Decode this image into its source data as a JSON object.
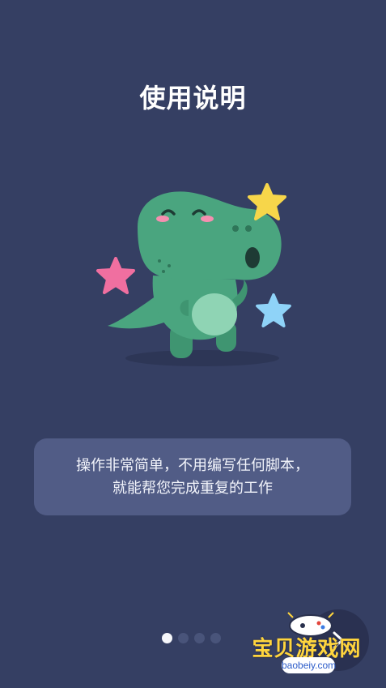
{
  "page": {
    "title": "使用说明"
  },
  "illustration": {
    "icon": "dinosaur-illustration"
  },
  "info_card": {
    "line1": "操作非常简单，不用编写任何脚本，",
    "line2": "就能帮您完成重复的工作"
  },
  "pagination": {
    "dots": 4,
    "active_index": 0
  },
  "next_button": {
    "icon": "chevron-right-icon"
  },
  "watermark": {
    "title": "宝贝游戏网",
    "site": "baobeiy.com"
  },
  "colors": {
    "background": "#353f63",
    "card": "#515c86",
    "dino": "#4aa57f",
    "star_yellow": "#f7d64a",
    "star_pink": "#f06fa0",
    "star_blue": "#8fd3f8"
  }
}
